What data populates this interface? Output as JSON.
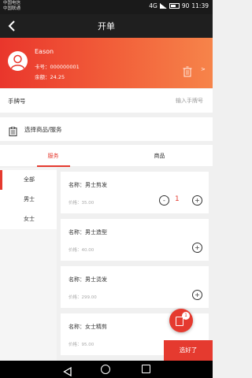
{
  "status_bar": {
    "carrier_1": "中国电信",
    "carrier_2": "中国联通",
    "network": "4G",
    "battery": "90",
    "time": "11:39"
  },
  "header": {
    "title": "开单"
  },
  "member": {
    "name": "Eason",
    "card_number": "卡号：000000001",
    "balance": "余额：24.25",
    "chevron": ">"
  },
  "hand_number": {
    "label": "手牌号",
    "placeholder": "输入手牌号",
    "value": ""
  },
  "select_goods": {
    "label": "选择商品/服务"
  },
  "tabs": [
    {
      "label": "服务",
      "active": true
    },
    {
      "label": "商品",
      "active": false
    }
  ],
  "categories": [
    {
      "label": "全部",
      "active": true
    },
    {
      "label": "男士",
      "active": false
    },
    {
      "label": "女士",
      "active": false
    }
  ],
  "products": [
    {
      "name": "名称：男士剪发",
      "price": "价格：35.00",
      "quantity": "1"
    },
    {
      "name": "名称：男士造型",
      "price": "价格：40.00"
    },
    {
      "name": "名称：男士烫发",
      "price": "价格：299.00"
    },
    {
      "name": "名称：女士精剪",
      "price": "价格：95.00"
    }
  ],
  "controls": {
    "minus": "-",
    "plus": "+"
  },
  "cart": {
    "badge": "1"
  },
  "done_button": {
    "label": "选好了"
  },
  "colors": {
    "accent": "#e53a2f",
    "header_bg": "#1f1f1f",
    "gradient_start": "#e9362c",
    "gradient_end": "#f6844a"
  }
}
